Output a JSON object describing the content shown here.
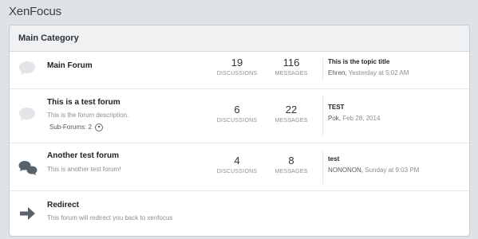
{
  "site": {
    "title": "XenFocus"
  },
  "category": {
    "title": "Main Category",
    "nodes": [
      {
        "title": "Main Forum",
        "description": "",
        "discussions": "19",
        "messages": "116",
        "discussions_label": "DISCUSSIONS",
        "messages_label": "MESSAGES",
        "last_title": "This is the topic title",
        "last_user": "Ehren",
        "last_date": "Yesterday at 5:02 AM",
        "icon": "speech-bubble-icon"
      },
      {
        "title": "This is a test forum",
        "description": "This is the forum description.",
        "subforums_label": "Sub-Forums: 2",
        "discussions": "6",
        "messages": "22",
        "discussions_label": "DISCUSSIONS",
        "messages_label": "MESSAGES",
        "last_title": "TEST",
        "last_user": "Pok",
        "last_date": "Feb 28, 2014",
        "icon": "speech-bubble-icon"
      },
      {
        "title": "Another test forum",
        "description": "This is another test forum!",
        "discussions": "4",
        "messages": "8",
        "discussions_label": "DISCUSSIONS",
        "messages_label": "MESSAGES",
        "last_title": "test",
        "last_user": "NONONON",
        "last_date": "Sunday at 9:03 PM",
        "icon": "two-speech-bubbles-icon"
      },
      {
        "title": "Redirect",
        "description": "This forum will redirect you back to xenfocus",
        "icon": "arrow-right-icon"
      }
    ]
  }
}
